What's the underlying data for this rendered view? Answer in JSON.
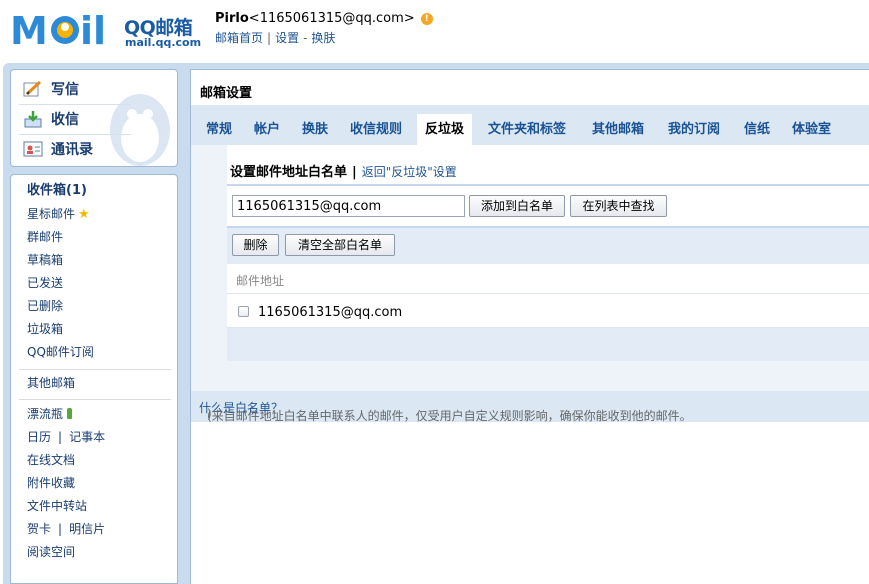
{
  "header": {
    "logo_text": "QQ邮箱",
    "logo_domain": "mail.qq.com",
    "user_name": "Pirlo",
    "user_email": "<1165061315@qq.com>",
    "warn_glyph": "!",
    "links": [
      "邮箱首页",
      "设置",
      "换肤"
    ],
    "separators": [
      "|",
      "-"
    ]
  },
  "actions": [
    {
      "label": "写信",
      "icon": "write-icon"
    },
    {
      "label": "收信",
      "icon": "receive-icon"
    },
    {
      "label": "通讯录",
      "icon": "contacts-icon"
    }
  ],
  "folders": {
    "group1": [
      "收件箱(1)",
      "星标邮件",
      "群邮件",
      "草稿箱",
      "已发送",
      "已删除",
      "垃圾箱",
      "QQ邮件订阅"
    ],
    "group2": [
      "其他邮箱"
    ],
    "group3": {
      "drift": "漂流瓶",
      "calendar": "日历",
      "notes": "记事本",
      "docs": "在线文档",
      "attach": "附件收藏",
      "transfer": "文件中转站",
      "card": "贺卡",
      "postcard": "明信片",
      "reading": "阅读空间",
      "pipe": "|"
    },
    "star_glyph": "★"
  },
  "main": {
    "title": "邮箱设置",
    "tabs": [
      "常规",
      "帐户",
      "换肤",
      "收信规则",
      "反垃圾",
      "文件夹和标签",
      "其他邮箱",
      "我的订阅",
      "信纸",
      "体验室"
    ],
    "active_tab": "反垃圾",
    "section": {
      "heading": "设置邮件地址白名单",
      "bar": "|",
      "back_link": "返回\"反垃圾\"设置",
      "input_value": "1165061315@qq.com",
      "add_button": "添加到白名单",
      "find_button": "在列表中查找",
      "delete_button": "删除",
      "clear_button": "清空全部白名单",
      "column_header": "邮件地址",
      "rows": [
        "1165061315@qq.com"
      ]
    },
    "note": {
      "text": "(来自邮件地址白名单中联系人的邮件，仅受用户自定义规则影响，确保你能收到他的邮件。",
      "link": "什么是白名单？",
      "close": ")"
    }
  }
}
